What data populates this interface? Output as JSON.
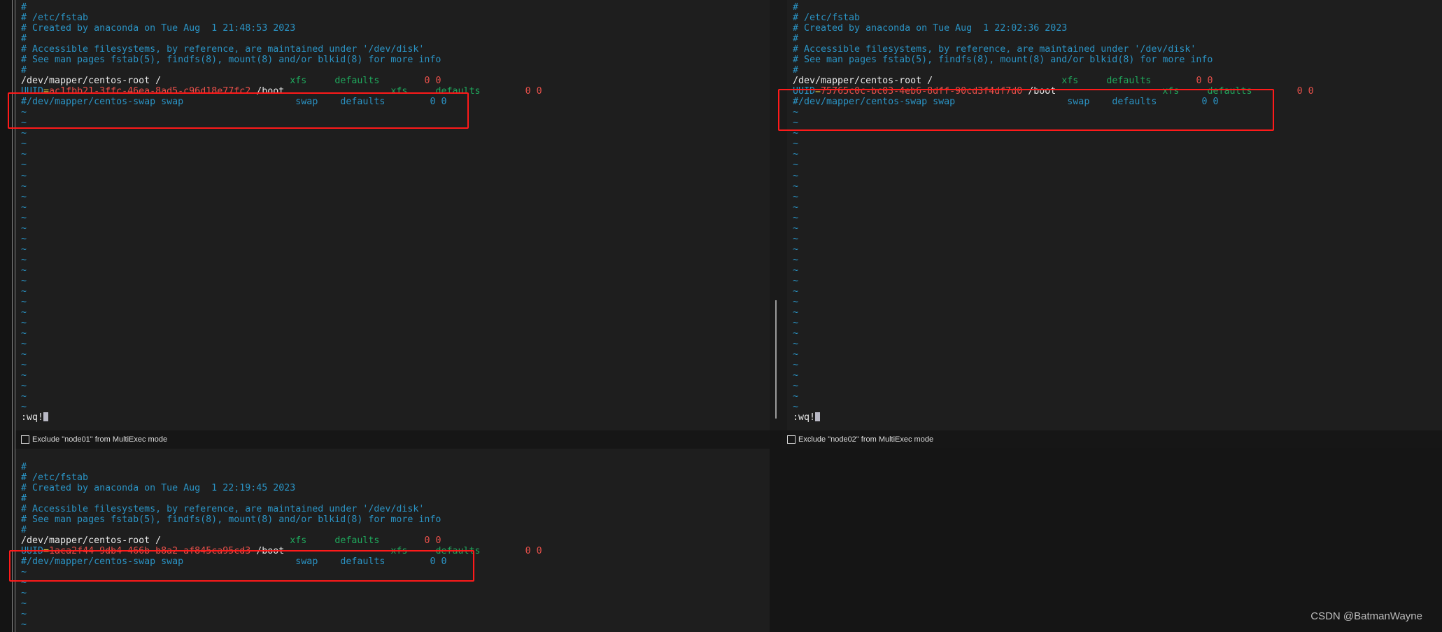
{
  "panes": [
    {
      "id": "node01",
      "header_lines": [
        "#",
        "# /etc/fstab",
        "# Created by anaconda on Tue Aug  1 21:48:53 2023",
        "#",
        "# Accessible filesystems, by reference, are maintained under '/dev/disk'",
        "# See man pages fstab(5), findfs(8), mount(8) and/or blkid(8) for more info",
        "#"
      ],
      "root_entry": {
        "device": "/dev/mapper/centos-root",
        "mount": "/",
        "type": "xfs",
        "options": "defaults",
        "dump_pass": "0 0"
      },
      "boot_entry": {
        "key": "UUID",
        "eq": "=",
        "uuid": "ac1fbb21-3ffc-46ea-8ad5-c96d18e77fc2",
        "mount": "/boot",
        "type": "xfs",
        "options": "defaults",
        "dump_pass": "0 0"
      },
      "swap_entry": {
        "device": "#/dev/mapper/centos-swap",
        "mount": "swap",
        "type": "swap",
        "options": "defaults",
        "dump_pass": "0 0"
      },
      "tilde_count": 29,
      "command": ":wq!",
      "exclude_label": "Exclude \"node01\" from MultiExec mode",
      "exclude_checked": false
    },
    {
      "id": "node02",
      "header_lines": [
        "#",
        "# /etc/fstab",
        "# Created by anaconda on Tue Aug  1 22:02:36 2023",
        "#",
        "# Accessible filesystems, by reference, are maintained under '/dev/disk'",
        "# See man pages fstab(5), findfs(8), mount(8) and/or blkid(8) for more info",
        "#"
      ],
      "root_entry": {
        "device": "/dev/mapper/centos-root",
        "mount": "/",
        "type": "xfs",
        "options": "defaults",
        "dump_pass": "0 0"
      },
      "boot_entry": {
        "key": "UUID",
        "eq": "=",
        "uuid": "75765c0c-bc03-4eb6-8dff-90cd3f4df7d0",
        "mount": "/boot",
        "type": "xfs",
        "options": "defaults",
        "dump_pass": "0 0"
      },
      "swap_entry": {
        "device": "#/dev/mapper/centos-swap",
        "mount": "swap",
        "type": "swap",
        "options": "defaults",
        "dump_pass": "0 0"
      },
      "tilde_count": 29,
      "command": ":wq!",
      "exclude_label": "Exclude \"node02\" from MultiExec mode",
      "exclude_checked": false
    },
    {
      "id": "node03",
      "header_lines": [
        "#",
        "# /etc/fstab",
        "# Created by anaconda on Tue Aug  1 22:19:45 2023",
        "#",
        "# Accessible filesystems, by reference, are maintained under '/dev/disk'",
        "# See man pages fstab(5), findfs(8), mount(8) and/or blkid(8) for more info",
        "#"
      ],
      "root_entry": {
        "device": "/dev/mapper/centos-root",
        "mount": "/",
        "type": "xfs",
        "options": "defaults",
        "dump_pass": "0 0"
      },
      "boot_entry": {
        "key": "UUID",
        "eq": "=",
        "uuid": "1aca2f44-9db4-466b-b8a2-af845ca95cd3",
        "mount": "/boot",
        "type": "xfs",
        "options": "defaults",
        "dump_pass": "0 0"
      },
      "swap_entry": {
        "device": "#/dev/mapper/centos-swap",
        "mount": "swap",
        "type": "swap",
        "options": "defaults",
        "dump_pass": "0 0"
      },
      "tilde_count": 6
    }
  ],
  "colors": {
    "comment": "#2a93c4",
    "fs_type": "#1fa85c",
    "number": "#e8504a",
    "highlight_box": "#ff1a1a",
    "background": "#1e1e1e"
  },
  "watermark": "CSDN @BatmanWayne"
}
